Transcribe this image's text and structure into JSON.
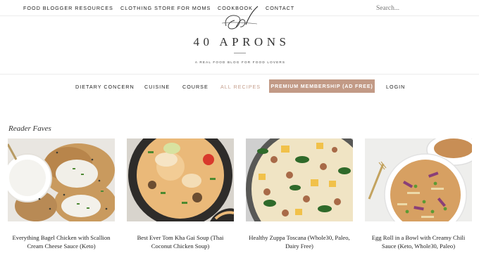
{
  "topnav": {
    "items": [
      {
        "label": "FOOD BLOGGER RESOURCES"
      },
      {
        "label": "CLOTHING STORE FOR MOMS"
      },
      {
        "label": "COOKBOOK"
      },
      {
        "label": "CONTACT"
      }
    ],
    "search_placeholder": "Search..."
  },
  "brand": {
    "title": "40 APRONS",
    "tagline": "A REAL FOOD BLOG FOR FOOD LOVERS"
  },
  "mainnav": {
    "items": [
      {
        "label": "DIETARY CONCERN"
      },
      {
        "label": "CUISINE"
      },
      {
        "label": "COURSE"
      },
      {
        "label": "ALL RECIPES",
        "active": true
      }
    ],
    "premium_label": "PREMIUM MEMBERSHIP (AD FREE)",
    "login_label": "LOGIN"
  },
  "section": {
    "title": "Reader Faves",
    "cards": [
      {
        "title": "Everything Bagel Chicken with Scallion Cream Cheese Sauce (Keto)",
        "image_icon": "bagel-chicken-photo"
      },
      {
        "title": "Best Ever Tom Kha Gai Soup (Thai Coconut Chicken Soup)",
        "image_icon": "tom-kha-soup-photo"
      },
      {
        "title": "Healthy Zuppa Toscana (Whole30, Paleo, Dairy Free)",
        "image_icon": "zuppa-toscana-photo"
      },
      {
        "title": "Egg Roll in a Bowl with Creamy Chili Sauce (Keto, Whole30, Paleo)",
        "image_icon": "egg-roll-bowl-photo"
      }
    ]
  },
  "colors": {
    "accent": "#c29a86",
    "active_link": "#c49e8c",
    "text": "#222222"
  }
}
